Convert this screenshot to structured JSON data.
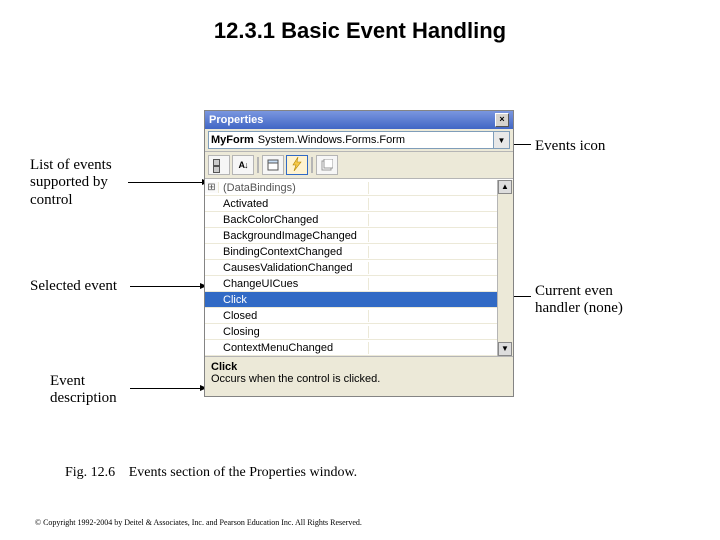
{
  "title": "12.3.1 Basic Event Handling",
  "annotations": {
    "events_icon": "Events icon",
    "list_of_events": "List of events\nsupported by\ncontrol",
    "selected_event": "Selected event",
    "current_handler": "Current even\nhandler (none)",
    "event_description": "Event\ndescription"
  },
  "panel": {
    "window_title": "Properties",
    "object_name": "MyForm",
    "object_type": "System.Windows.Forms.Form",
    "toolbar": {
      "categorized": "categorized-icon",
      "alphabetical": "alphabetical-icon",
      "properties": "properties-icon",
      "events": "events-icon",
      "property_pages": "property-pages-icon"
    },
    "rows": [
      {
        "gutter": "⊞",
        "name": "(DataBindings)",
        "value": "",
        "db": true
      },
      {
        "gutter": "",
        "name": "Activated",
        "value": ""
      },
      {
        "gutter": "",
        "name": "BackColorChanged",
        "value": ""
      },
      {
        "gutter": "",
        "name": "BackgroundImageChanged",
        "value": ""
      },
      {
        "gutter": "",
        "name": "BindingContextChanged",
        "value": ""
      },
      {
        "gutter": "",
        "name": "CausesValidationChanged",
        "value": ""
      },
      {
        "gutter": "",
        "name": "ChangeUICues",
        "value": ""
      },
      {
        "gutter": "",
        "name": "Click",
        "value": "",
        "selected": true
      },
      {
        "gutter": "",
        "name": "Closed",
        "value": ""
      },
      {
        "gutter": "",
        "name": "Closing",
        "value": ""
      },
      {
        "gutter": "",
        "name": "ContextMenuChanged",
        "value": ""
      }
    ],
    "description": {
      "title": "Click",
      "text": "Occurs when the control is clicked."
    }
  },
  "figure": {
    "number": "Fig. 12.6",
    "caption": "Events section of the Properties window."
  },
  "copyright": "© Copyright 1992-2004 by Deitel & Associates, Inc. and Pearson Education Inc. All Rights Reserved."
}
